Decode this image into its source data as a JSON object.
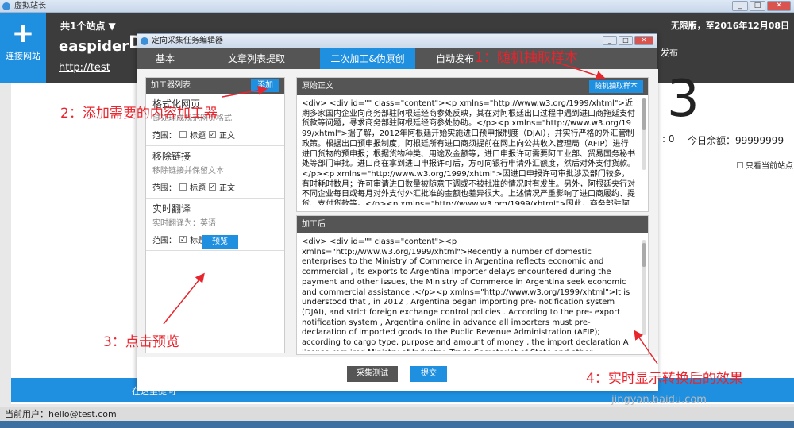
{
  "app": {
    "title": "虚拟站长",
    "site_count": "共1个站点",
    "license": "无限版，至2016年12月08日",
    "add_site_label": "连接网站",
    "current_site": {
      "name": "easpider",
      "url": "http://test",
      "partial_char": "D",
      "big_number": "3",
      "right_label": "发布",
      "stat_zero": ": 0",
      "balance": "今日余额：99999999",
      "only_current": "只看当前站点",
      "bottom_button": "在这里提问"
    },
    "status_bar": "当前用户：hello@test.com"
  },
  "dialog": {
    "title": "定向采集任务编辑器",
    "tabs": [
      {
        "label": "基本",
        "active": false
      },
      {
        "label": "文章列表提取",
        "active": false
      },
      {
        "label": "二次加工&伪原创",
        "active": true
      },
      {
        "label": "自动发布",
        "active": false
      }
    ],
    "processors": {
      "header": "加工器列表",
      "add_label": "添加",
      "items": [
        {
          "name": "格式化网页",
          "desc": "键处理成规范网页格式",
          "scope_label": "范围：",
          "title_label": "标题",
          "title_checked": false,
          "body_label": "正文",
          "body_checked": true
        },
        {
          "name": "移除链接",
          "desc": "移除链接并保留文本",
          "scope_label": "范围：",
          "title_label": "标题",
          "title_checked": false,
          "body_label": "正文",
          "body_checked": true
        },
        {
          "name": "实时翻译",
          "desc": "实时翻译为：英语",
          "scope_label": "范围：",
          "title_label": "标题",
          "title_checked": true,
          "body_label": "正文",
          "body_checked": true
        }
      ],
      "preview_label": "预览"
    },
    "original": {
      "header": "原始正文",
      "sample_label": "随机抽取样本",
      "text": "<div> <div id=\"\" class=\"content\"><p xmlns=\"http://www.w3.org/1999/xhtml\">近期多家国内企业向商务部驻阿根廷经商参处反映，其在对阿根廷出口过程中遇到进口商拖延支付货款等问题，寻求商务部驻阿根廷经商参处协助。</p><p xmlns=\"http://www.w3.org/1999/xhtml\">据了解，2012年阿根廷开始实施进口预申报制度（DJAI），并实行严格的外汇管制政策。根据出口预申报制度，阿根廷所有进口商须提前在网上向公共收入管理局（AFIP）进行进口货物的预申报；根据货物种类、用途及金额等，进口申报许可需要阿工业部、贸易国务秘书处等部门审批。进口商在拿到进口申报许可后，方可向银行申请外汇额度，然后对外支付货款。</p><p xmlns=\"http://www.w3.org/1999/xhtml\">因进口申报许可审批涉及部门较多，有时耗时数月；许可审请进口数量被随意下调或不被批准的情况时有发生。另外，阿根廷央行对不同企业每日或每月对外支付外汇批准的金额也差异很大。上述情况严重影响了进口商履约、提货、支付货款等。</p><p xmlns=\"http://www.w3.org/1999/xhtml\">因此，商务部驻阿根廷经商参处提醒国内企业在与阿根廷进口商订立货"
    },
    "processed": {
      "header": "加工后",
      "text": "<div> <div id=\"\" class=\"content\"><p xmlns=\"http://www.w3.org/1999/xhtml\">Recently a number of domestic enterprises to the Ministry of Commerce in Argentina reflects economic and commercial , its exports to Argentina Importer delays encountered during the payment and other issues, the Ministry of Commerce in Argentina seek economic and commercial assistance .</p><p xmlns=\"http://www.w3.org/1999/xhtml\">It is understood that , in 2012 , Argentina began importing pre- notification system (DJAI), and strict foreign exchange control policies . According to the pre- export notification system , Argentina online in advance all importers must pre- declaration of imported goods to the Public Revenue Administration (AFIP); according to cargo type, purpose and amount of money , the import declaration A license required Ministry of Industry, Trade Secretariat of State and other departments for approval. Importer import declaration in getting permission from the banks for foreign exchange quota , then the external payment .</p><p xmlns=\"http://"
    },
    "footer": {
      "collect_test_label": "采集测试",
      "submit_label": "提交"
    }
  },
  "annotations": {
    "step1": "1：随机抽取样本",
    "step2": "2：添加需要的内容加工器",
    "step3": "3：点击预览",
    "step4": "4：实时显示转换后的效果"
  },
  "watermark": "jingyan.baidu.com",
  "colors": {
    "accent": "#1f8fe0",
    "header_dark": "#555555",
    "annotation_red": "#e8242d"
  }
}
